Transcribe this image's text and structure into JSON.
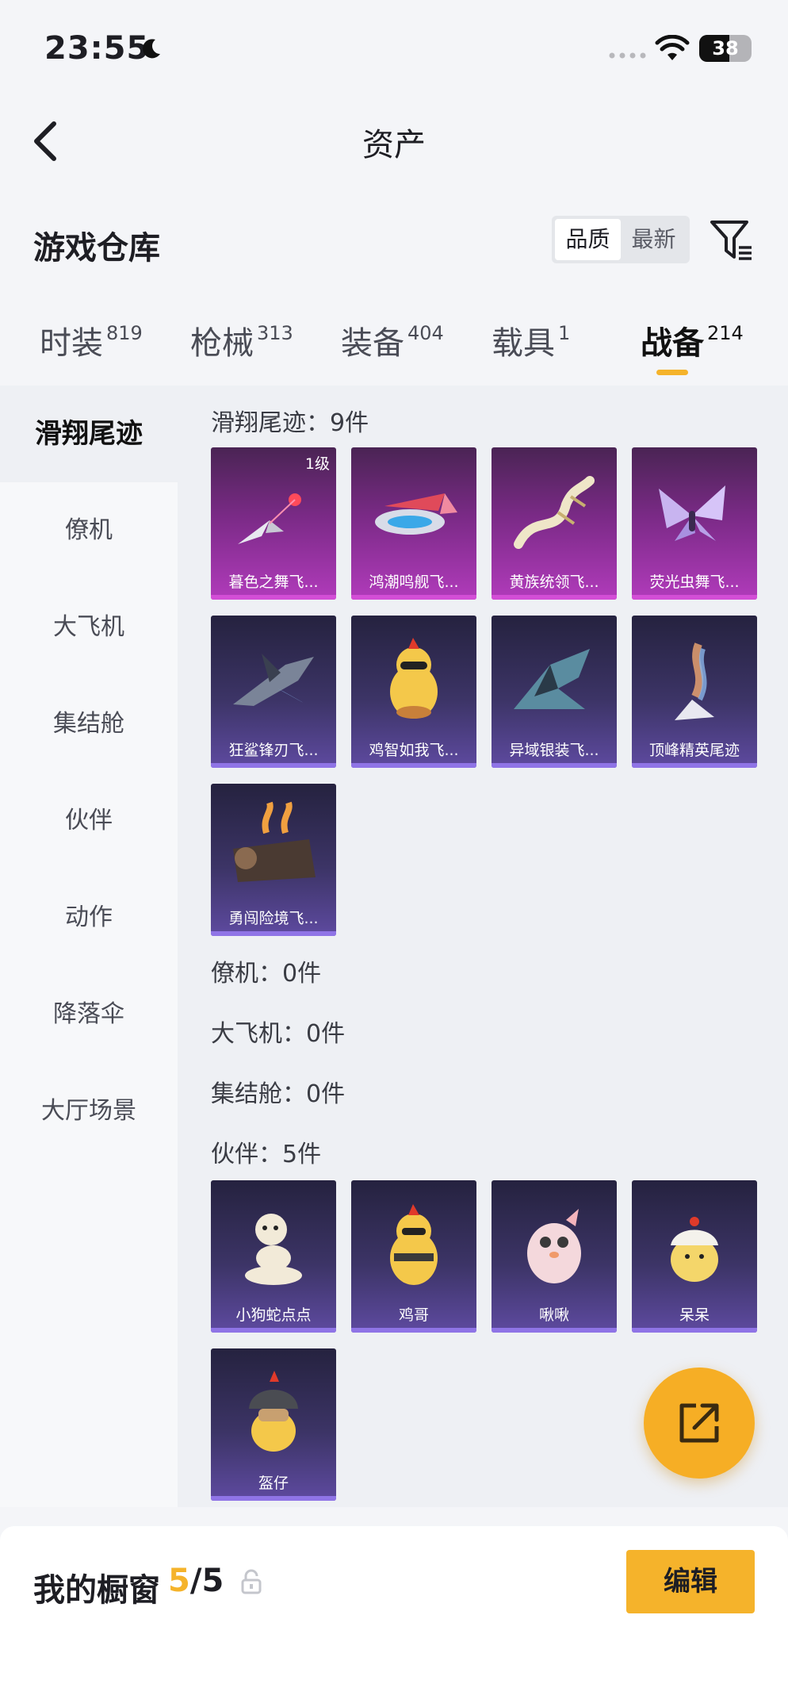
{
  "status_bar": {
    "time": "23:55",
    "battery": "38"
  },
  "nav": {
    "title": "资产"
  },
  "header": {
    "title": "游戏仓库",
    "sort_options": [
      "品质",
      "最新"
    ],
    "active_sort": "品质"
  },
  "tabs": [
    {
      "label": "时装",
      "count": "819"
    },
    {
      "label": "枪械",
      "count": "313"
    },
    {
      "label": "装备",
      "count": "404"
    },
    {
      "label": "载具",
      "count": "1"
    },
    {
      "label": "战备",
      "count": "214",
      "active": true
    }
  ],
  "sidebar": [
    "滑翔尾迹",
    "僚机",
    "大飞机",
    "集结舱",
    "伙伴",
    "动作",
    "降落伞",
    "大厅场景"
  ],
  "sections": {
    "glide": {
      "label": "滑翔尾迹：9件",
      "items": [
        {
          "name": "暮色之舞飞...",
          "level": "1级"
        },
        {
          "name": "鸿潮鸣舰飞..."
        },
        {
          "name": "黄族统领飞..."
        },
        {
          "name": "荧光虫舞飞..."
        },
        {
          "name": "狂鲨锋刃飞..."
        },
        {
          "name": "鸡智如我飞..."
        },
        {
          "name": "异域银装飞..."
        },
        {
          "name": "顶峰精英尾迹"
        },
        {
          "name": "勇闯险境飞..."
        }
      ]
    },
    "wingman": {
      "label": "僚机：0件"
    },
    "bigplane": {
      "label": "大飞机：0件"
    },
    "pod": {
      "label": "集结舱：0件"
    },
    "partner": {
      "label": "伙伴：5件",
      "items": [
        {
          "name": "小狗蛇点点"
        },
        {
          "name": "鸡哥"
        },
        {
          "name": "啾啾"
        },
        {
          "name": "呆呆"
        },
        {
          "name": "盔仔"
        }
      ]
    }
  },
  "bottom": {
    "label": "我的橱窗",
    "current": "5",
    "total": "/5",
    "edit": "编辑"
  },
  "colors": {
    "accent": "#f5b32b",
    "purple_card": "#b13bbb",
    "blue_card": "#5e4aa0"
  }
}
